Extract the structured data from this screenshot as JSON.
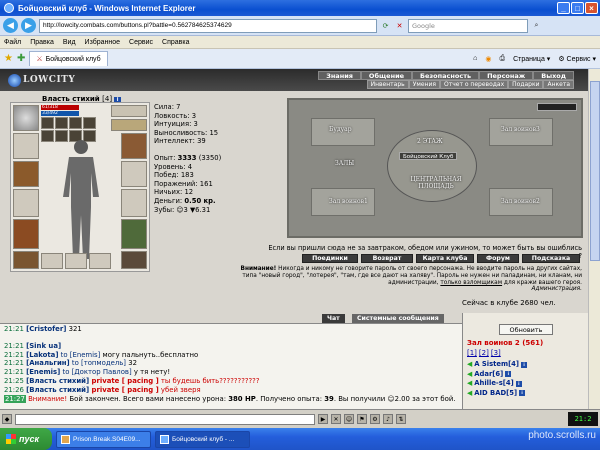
{
  "window": {
    "title": "Бойцовский клуб - Windows Internet Explorer",
    "url": "http://lowcity.combats.com/buttons.pl?battle=0.562784625374629",
    "search_placeholder": "Google",
    "tab_title": "Бойцовский клуб",
    "page_label": "Страница",
    "service_label": "Сервис"
  },
  "menu": [
    "Файл",
    "Правка",
    "Вид",
    "Избранное",
    "Сервис",
    "Справка"
  ],
  "game": {
    "logo": "LOWCITY",
    "nav_top": [
      "Знания",
      "Общение",
      "Безопасность",
      "Персонаж",
      "Выход"
    ],
    "nav_bottom": [
      "Инвентарь",
      "Умения",
      "Отчет о переводах",
      "Подарки",
      "Анкета"
    ],
    "character": {
      "name": "Власть стихий",
      "level": "[4]",
      "hp": "61/318",
      "mp": "33/492",
      "stats": [
        {
          "label": "Сила",
          "value": "7"
        },
        {
          "label": "Ловкость",
          "value": "3"
        },
        {
          "label": "Интуиция",
          "value": "3"
        },
        {
          "label": "Выносливость",
          "value": "15"
        },
        {
          "label": "Интеллект",
          "value": "39"
        }
      ],
      "exp_label": "Опыт:",
      "exp": "3333",
      "exp_next": "(3350)",
      "details": [
        {
          "label": "Уровень:",
          "value": "4"
        },
        {
          "label": "Побед:",
          "value": "183"
        },
        {
          "label": "Поражений:",
          "value": "161"
        },
        {
          "label": "Ничьих:",
          "value": "12"
        }
      ],
      "money_label": "Деньги:",
      "money": "0.50 кр.",
      "teeth": "Зубы: ☺3 ▼6.31"
    },
    "map": {
      "labels": {
        "buduar": "Будуар",
        "hall3": "Зал воинов3",
        "floor2": "2 ЭТАЖ",
        "club": "Бойцовский Клуб",
        "halls": "ЗАЛЫ",
        "hall1": "Зал воинов1",
        "central": "ЦЕНТРАЛЬНАЯ ПЛОЩАДЬ",
        "hall2": "Зал воинов2"
      },
      "note": "Если вы пришли сюда не за завтраком, обедом или ужином, то может быть вы ошиблись этажом?"
    },
    "buttons": [
      "Поединки",
      "Возврат",
      "Карта клуба",
      "Форум",
      "Подсказка"
    ],
    "warning": {
      "bold": "Внимание!",
      "text": " Никогда и никому не говорите пароль от своего персонажа. Не вводите пароль на других сайтах, типа \"новый город\", \"лотерея\", \"там, где все дают на халяву\". Пароль не нужен ни паладинам, ни кланам, ни администрации, ",
      "underlined": "только взломщикам",
      "text2": " для кражи вашего героя.",
      "sign": "Администрация."
    },
    "online": "Сейчас в клубе 2680 чел."
  },
  "chat": {
    "tabs": [
      "Чат",
      "Системные сообщения"
    ],
    "lines": [
      {
        "time": "21:21",
        "nick": "[Cristofer]",
        "rest": " 321"
      },
      {
        "time": "21:21",
        "nick": "[Sink ua]",
        "rest": ""
      },
      {
        "time": "21:21",
        "nick": "[Lakota]",
        "to": " to [Enemis]",
        "rest": " могу пальнуть..бесплатно"
      },
      {
        "time": "21:21",
        "nick": "[Анальгин]",
        "to": " to [топмодель]",
        "rest": " 32"
      },
      {
        "time": "21:21",
        "nick": "[Enemis]",
        "to": " to [Доктор Павлов]",
        "rest": " у тя нету!"
      },
      {
        "time": "21:25",
        "nick": "[Власть стихий]",
        "priv": " private [ pacing ]",
        "rest": " ты будешь бить???????????"
      },
      {
        "time": "21:26",
        "nick": "[Власть стихий]",
        "priv": " private [ pacing ]",
        "rest": " убей зверя"
      }
    ],
    "system_time": "21:27",
    "system_warn": "Внимание!",
    "system_text": " Бой закончен. Всего вами нанесено урона: ",
    "damage": "380 HP",
    "system_text2": ". Получено опыта: ",
    "exp": "39",
    "system_text3": ". Вы получили ☺2.00 за этот бой."
  },
  "online_panel": {
    "refresh": "Обновить",
    "room": "Зал воинов 2 (561)",
    "pages": [
      "[1]",
      "[2]",
      "[3]"
    ],
    "users": [
      "A Sistem[4]",
      "Adar[6]",
      "Ahille-s[4]",
      "AID BAD[5]"
    ]
  },
  "taskbar": {
    "start": "пуск",
    "tasks": [
      "Prison.Break.S04E09...",
      "Бойцовский клуб - ..."
    ]
  },
  "watermark": "photo.scrolls.ru"
}
